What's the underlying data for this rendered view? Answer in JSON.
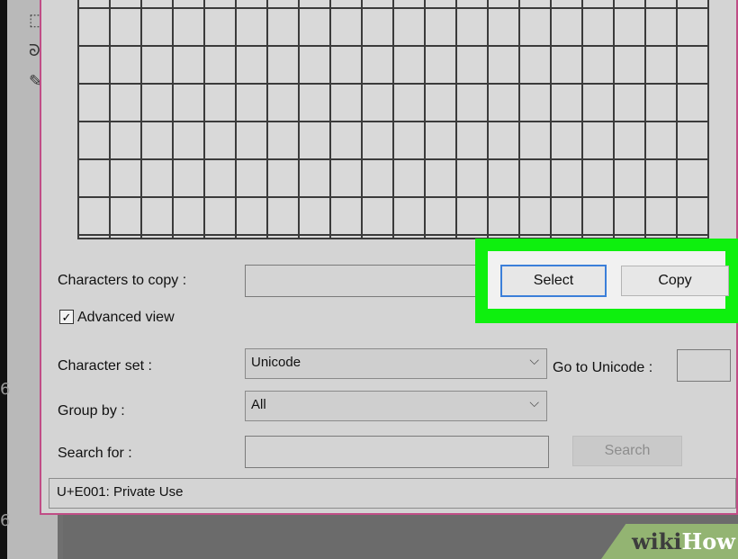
{
  "labels": {
    "chars_to_copy": "Characters to copy :",
    "advanced_view": "Advanced view",
    "character_set": "Character set :",
    "group_by": "Group by :",
    "search_for": "Search for :",
    "go_to_unicode": "Go to Unicode :"
  },
  "buttons": {
    "select": "Select",
    "copy": "Copy",
    "search": "Search"
  },
  "fields": {
    "chars_to_copy_value": "",
    "character_set_value": "Unicode",
    "group_by_value": "All",
    "search_value": "",
    "go_to_unicode_value": ""
  },
  "checkbox": {
    "advanced_view_checked": true,
    "check_glyph": "✓"
  },
  "status": {
    "text": "U+E001: Private Use"
  },
  "edge_numbers": [
    "6",
    "6"
  ],
  "watermark": {
    "part1": "wiki",
    "part2": "How"
  },
  "colors": {
    "highlight": "#0ef00e",
    "dialog_border": "#c04d86",
    "primary_border": "#3b7fd9"
  },
  "icons": [
    "rect-select-icon",
    "lasso-icon",
    "pencil-icon",
    "chevron-down-icon",
    "check-icon"
  ]
}
